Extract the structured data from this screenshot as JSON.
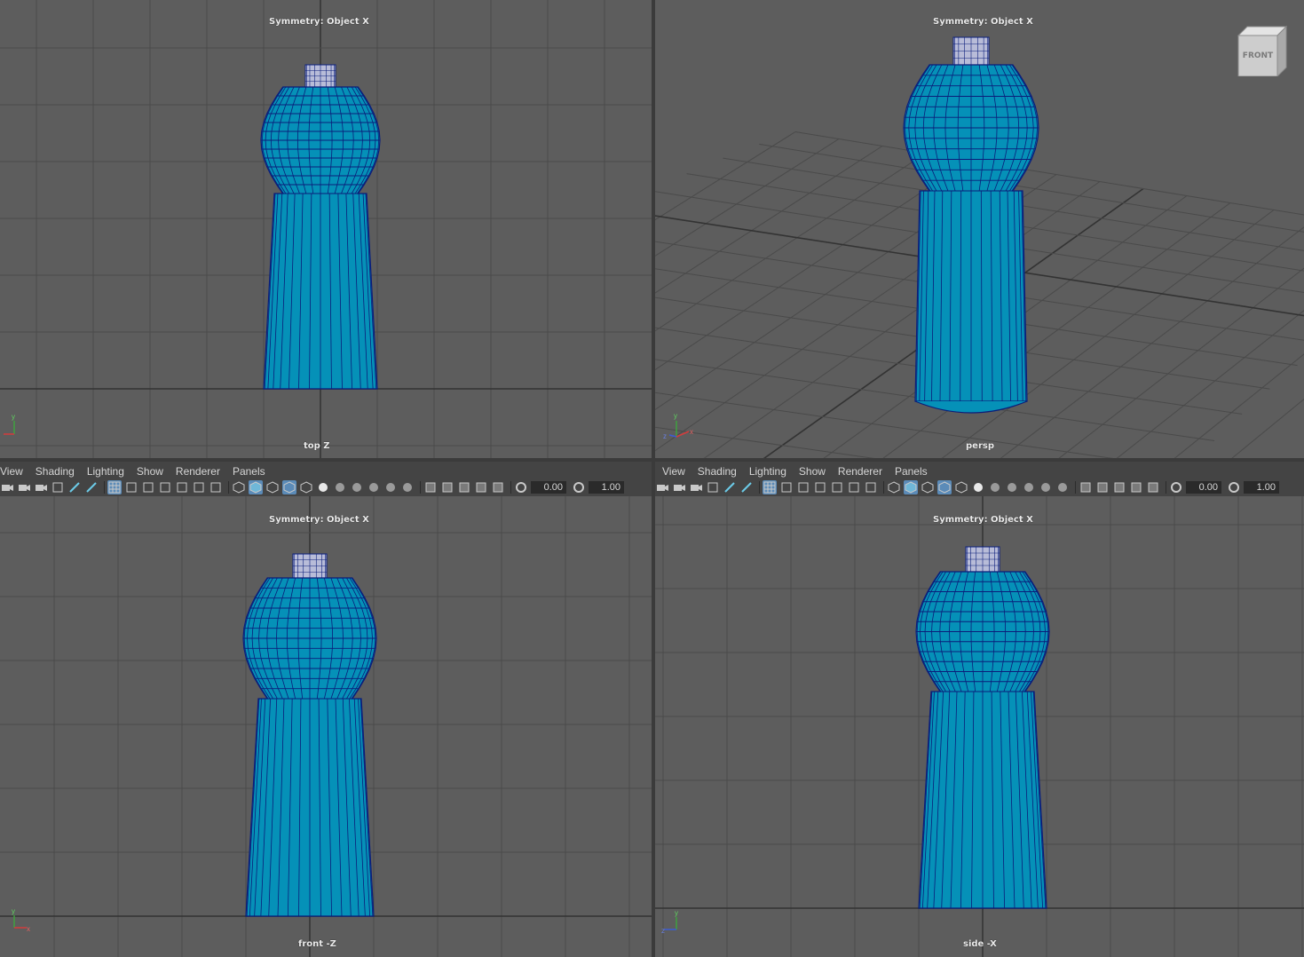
{
  "symmetry_label": "Symmetry: Object X",
  "viewports": {
    "top": {
      "camera": "top Z"
    },
    "persp": {
      "camera": "persp",
      "view_cube": "FRONT"
    },
    "front": {
      "camera": "front -Z"
    },
    "side": {
      "camera": "side -X"
    }
  },
  "panel_menu": [
    "View",
    "Shading",
    "Lighting",
    "Show",
    "Renderer",
    "Panels"
  ],
  "panel_toolbar": {
    "exposure": "0.00",
    "gamma": "1.00",
    "icons": [
      "select-camera-icon",
      "camera-attributes-icon",
      "bookmarks-icon",
      "image-plane-icon",
      "2d-pan-zoom-icon",
      "grease-pencil-icon",
      "grid-icon",
      "film-gate-icon",
      "resolution-gate-icon",
      "gate-mask-icon",
      "field-chart-icon",
      "safe-action-icon",
      "safe-title-icon",
      "wireframe-icon",
      "smooth-shade-icon",
      "default-material-icon",
      "wireframe-on-shaded-icon",
      "textured-icon",
      "use-all-lights-icon",
      "shadows-icon",
      "screen-space-ambient-occlusion-icon",
      "motion-blur-icon",
      "anti-aliasing-icon",
      "depth-of-field-icon",
      "isolate-select-icon",
      "xray-icon",
      "xray-active-components-icon",
      "xray-joints-icon",
      "backface-culling-icon",
      "exposure-icon",
      "gamma-icon"
    ]
  },
  "colors": {
    "viewport_bg": "#5d5d5d",
    "grid_line": "#4a4a4a",
    "grid_axis": "#333333",
    "mesh_fill": "#0591b8",
    "mesh_wire": "#0b1e7a",
    "panel_bg": "#444444"
  }
}
